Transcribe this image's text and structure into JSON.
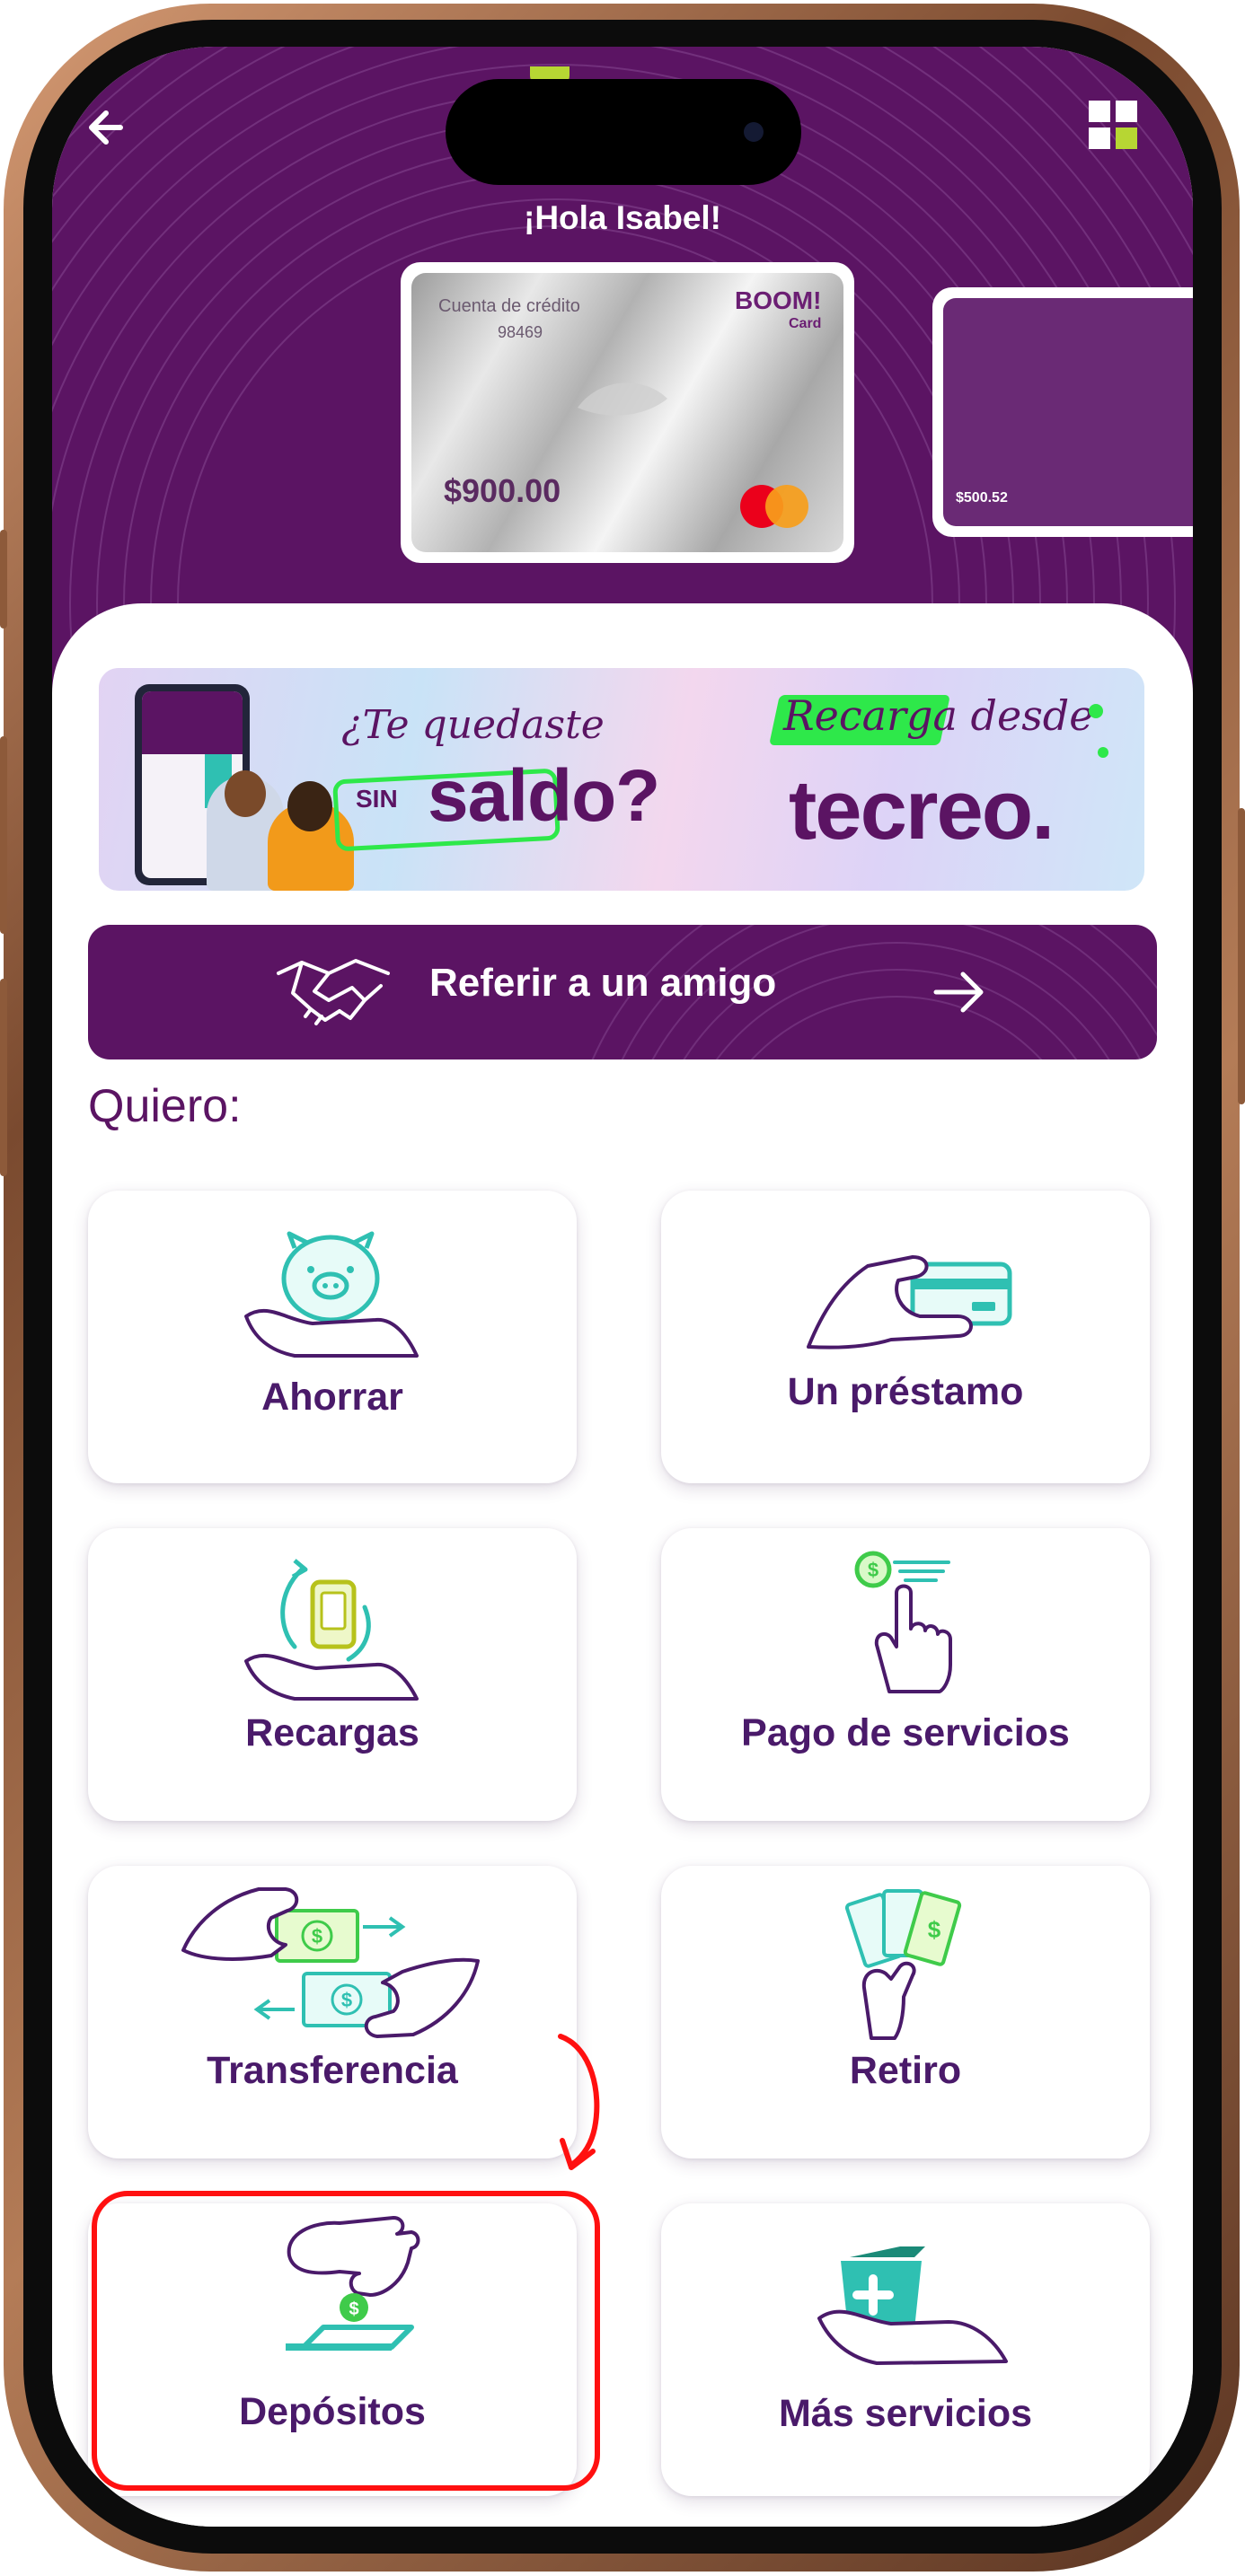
{
  "header": {
    "greeting": "¡Hola Isabel!",
    "back_icon": "arrow-left-icon",
    "menu_icon": "grid-icon"
  },
  "cards": {
    "main": {
      "label": "Cuenta de crédito",
      "number": "98469",
      "brand": "BOOM!",
      "brand_sub": "Card",
      "amount": "$900.00",
      "network_icon": "mastercard-logo"
    },
    "secondary": {
      "amount": "$500.52"
    }
  },
  "banner": {
    "question_line1": "¿Te quedaste",
    "question_sin": "SIN",
    "question_saldo": "saldo?",
    "cta": "Recarga desde",
    "brand": "tecreo."
  },
  "refer": {
    "label": "Referir a un amigo",
    "icon": "handshake-icon",
    "arrow_icon": "arrow-right-icon"
  },
  "section_title": "Quiero:",
  "tiles": [
    {
      "label": "Ahorrar",
      "icon": "piggy-bank-icon"
    },
    {
      "label": "Un préstamo",
      "icon": "hand-card-icon"
    },
    {
      "label": "Recargas",
      "icon": "phone-recharge-icon"
    },
    {
      "label": "Pago de servicios",
      "icon": "tap-payment-icon"
    },
    {
      "label": "Transferencia",
      "icon": "money-transfer-icon"
    },
    {
      "label": "Retiro",
      "icon": "cash-withdraw-icon"
    },
    {
      "label": "Depósitos",
      "icon": "coin-deposit-icon"
    },
    {
      "label": "Más servicios",
      "icon": "more-services-icon"
    }
  ],
  "colors": {
    "primary": "#5b1463",
    "accent_teal": "#2fc0b2",
    "accent_green": "#2ee84a",
    "highlight_red": "#ff1010"
  }
}
